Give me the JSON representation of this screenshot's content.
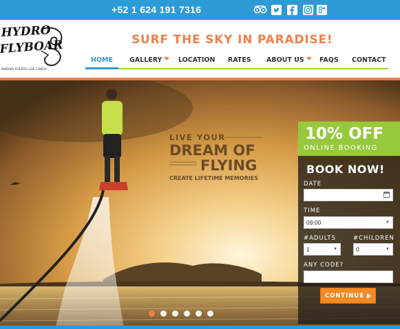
{
  "topbar": {
    "phone": "+52 1 624 191 7316",
    "social_icons": [
      "tripadvisor-icon",
      "twitter-icon",
      "facebook-icon",
      "instagram-icon",
      "google-plus-icon"
    ]
  },
  "logo": {
    "line1": "HYDRO",
    "line2": "FLYBOAR",
    "subtitle": "MARINA PUERTO LOS CABOS"
  },
  "tagline": "SURF THE SKY IN PARADISE!",
  "nav": {
    "items": [
      {
        "label": "HOME",
        "active": true
      },
      {
        "label": "GALLERY",
        "dropdown": true
      },
      {
        "label": "LOCATION"
      },
      {
        "label": "RATES"
      },
      {
        "label": "ABOUT US",
        "dropdown": true
      },
      {
        "label": "FAQS"
      },
      {
        "label": "CONTACT"
      }
    ]
  },
  "hero": {
    "line1": "LIVE YOUR",
    "line2": "DREAM OF",
    "line3": "FLYING",
    "line4": "CREATE LIFETIME MEMORIES",
    "slides": 6,
    "active_slide": 0
  },
  "promo": {
    "percent": "10% OFF",
    "subtitle": "ONLINE BOOKING"
  },
  "booking": {
    "title": "BOOK NOW!",
    "date_label": "DATE",
    "date_value": "",
    "time_label": "TIME",
    "time_value": "09:00",
    "adults_label": "#ADULTS",
    "adults_value": "1",
    "children_label": "#CHILDREN",
    "children_value": "0",
    "code_label": "ANY CODE?",
    "code_value": "",
    "continue_label": "CONTINUE"
  },
  "colors": {
    "topbar": "#2e9ad6",
    "accent_orange": "#f0804a",
    "accent_green": "#97c93d",
    "button": "#f38a22"
  }
}
